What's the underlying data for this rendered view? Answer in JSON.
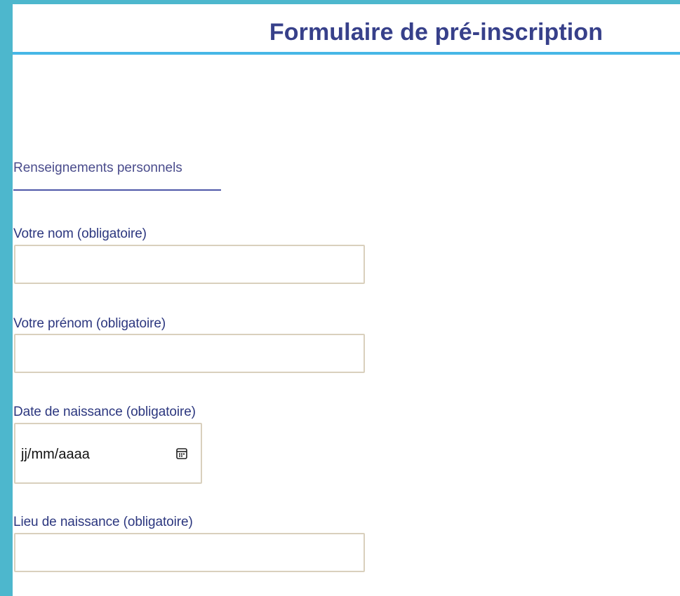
{
  "form": {
    "title": "Formulaire de pré-inscription",
    "section_title": "Renseignements personnels",
    "fields": {
      "nom": {
        "label": "Votre nom (obligatoire)",
        "value": ""
      },
      "prenom": {
        "label": "Votre prénom (obligatoire)",
        "value": ""
      },
      "date_naissance": {
        "label": "Date de naissance (obligatoire)",
        "placeholder": "jj/mm/aaaa",
        "icon": "calendar-icon"
      },
      "lieu_naissance": {
        "label": "Lieu de naissance (obligatoire)",
        "value": ""
      }
    }
  },
  "colors": {
    "frame": "#4db7cd",
    "title_text": "#37408a",
    "title_rule": "#46b7e6",
    "section_text": "#4a4c8c",
    "label_text": "#2c377f",
    "input_border": "#d9d0bd"
  }
}
